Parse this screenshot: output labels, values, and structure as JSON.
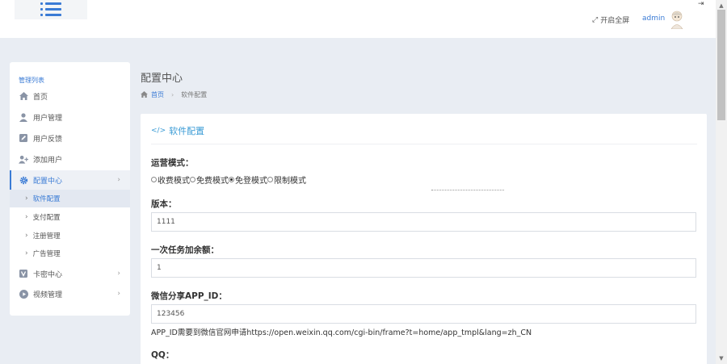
{
  "header": {
    "fullscreen_label": "开启全屏",
    "user_name": "admin"
  },
  "sidebar": {
    "title": "管理列表",
    "items": [
      {
        "label": "首页",
        "icon": "home-icon"
      },
      {
        "label": "用户管理",
        "icon": "user-icon"
      },
      {
        "label": "用户反馈",
        "icon": "edit-icon"
      },
      {
        "label": "添加用户",
        "icon": "user-plus-icon"
      },
      {
        "label": "配置中心",
        "icon": "gear-icon",
        "active": true,
        "expanded": true
      },
      {
        "label": "卡密中心",
        "icon": "vcard-icon"
      },
      {
        "label": "视频管理",
        "icon": "play-circle-icon"
      }
    ],
    "sub_items": [
      {
        "label": "软件配置",
        "active": true
      },
      {
        "label": "支付配置"
      },
      {
        "label": "注册管理"
      },
      {
        "label": "广告管理"
      }
    ]
  },
  "page": {
    "title": "配置中心",
    "breadcrumb": {
      "home": "首页",
      "current": "软件配置"
    }
  },
  "card": {
    "title": "软件配置",
    "title_icon": "</>"
  },
  "form": {
    "mode_label": "运营模式：",
    "mode_options": [
      "收费模式",
      "免费模式",
      "免登模式",
      "限制模式"
    ],
    "mode_selected": "免登模式",
    "version_label": "版本：",
    "version_value": "1111",
    "bonus_label": "一次任务加余额：",
    "bonus_value": "1",
    "wechat_label": "微信分享APP_ID：",
    "wechat_value": "123456",
    "wechat_help": "APP_ID需要到微信官网申请https://open.weixin.qq.com/cgi-bin/frame?t=home/app_tmpl&lang=zh_CN",
    "qq_label": "QQ："
  },
  "colors": {
    "accent": "#3a7bd5",
    "page_bg": "#e9edf3"
  }
}
